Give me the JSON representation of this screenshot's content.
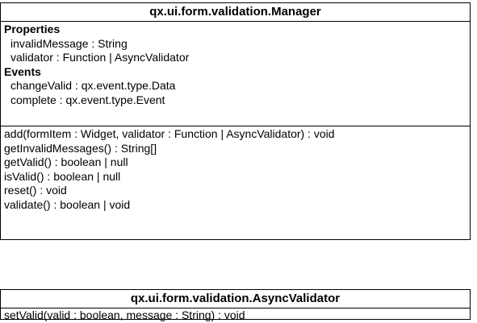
{
  "manager": {
    "title": "qx.ui.form.validation.Manager",
    "properties_heading": "Properties",
    "properties": [
      "invalidMessage : String",
      "validator : Function | AsyncValidator"
    ],
    "events_heading": "Events",
    "events": [
      "changeValid : qx.event.type.Data",
      "complete : qx.event.type.Event"
    ],
    "methods": [
      "add(formItem : Widget, validator : Function | AsyncValidator) : void",
      "getInvalidMessages() : String[]",
      "getValid() : boolean | null",
      "isValid() : boolean | null",
      "reset() : void",
      "validate() : boolean | void"
    ]
  },
  "async_validator": {
    "title": "qx.ui.form.validation.AsyncValidator",
    "methods": [
      "setValid(valid : boolean, message : String) : void"
    ]
  }
}
